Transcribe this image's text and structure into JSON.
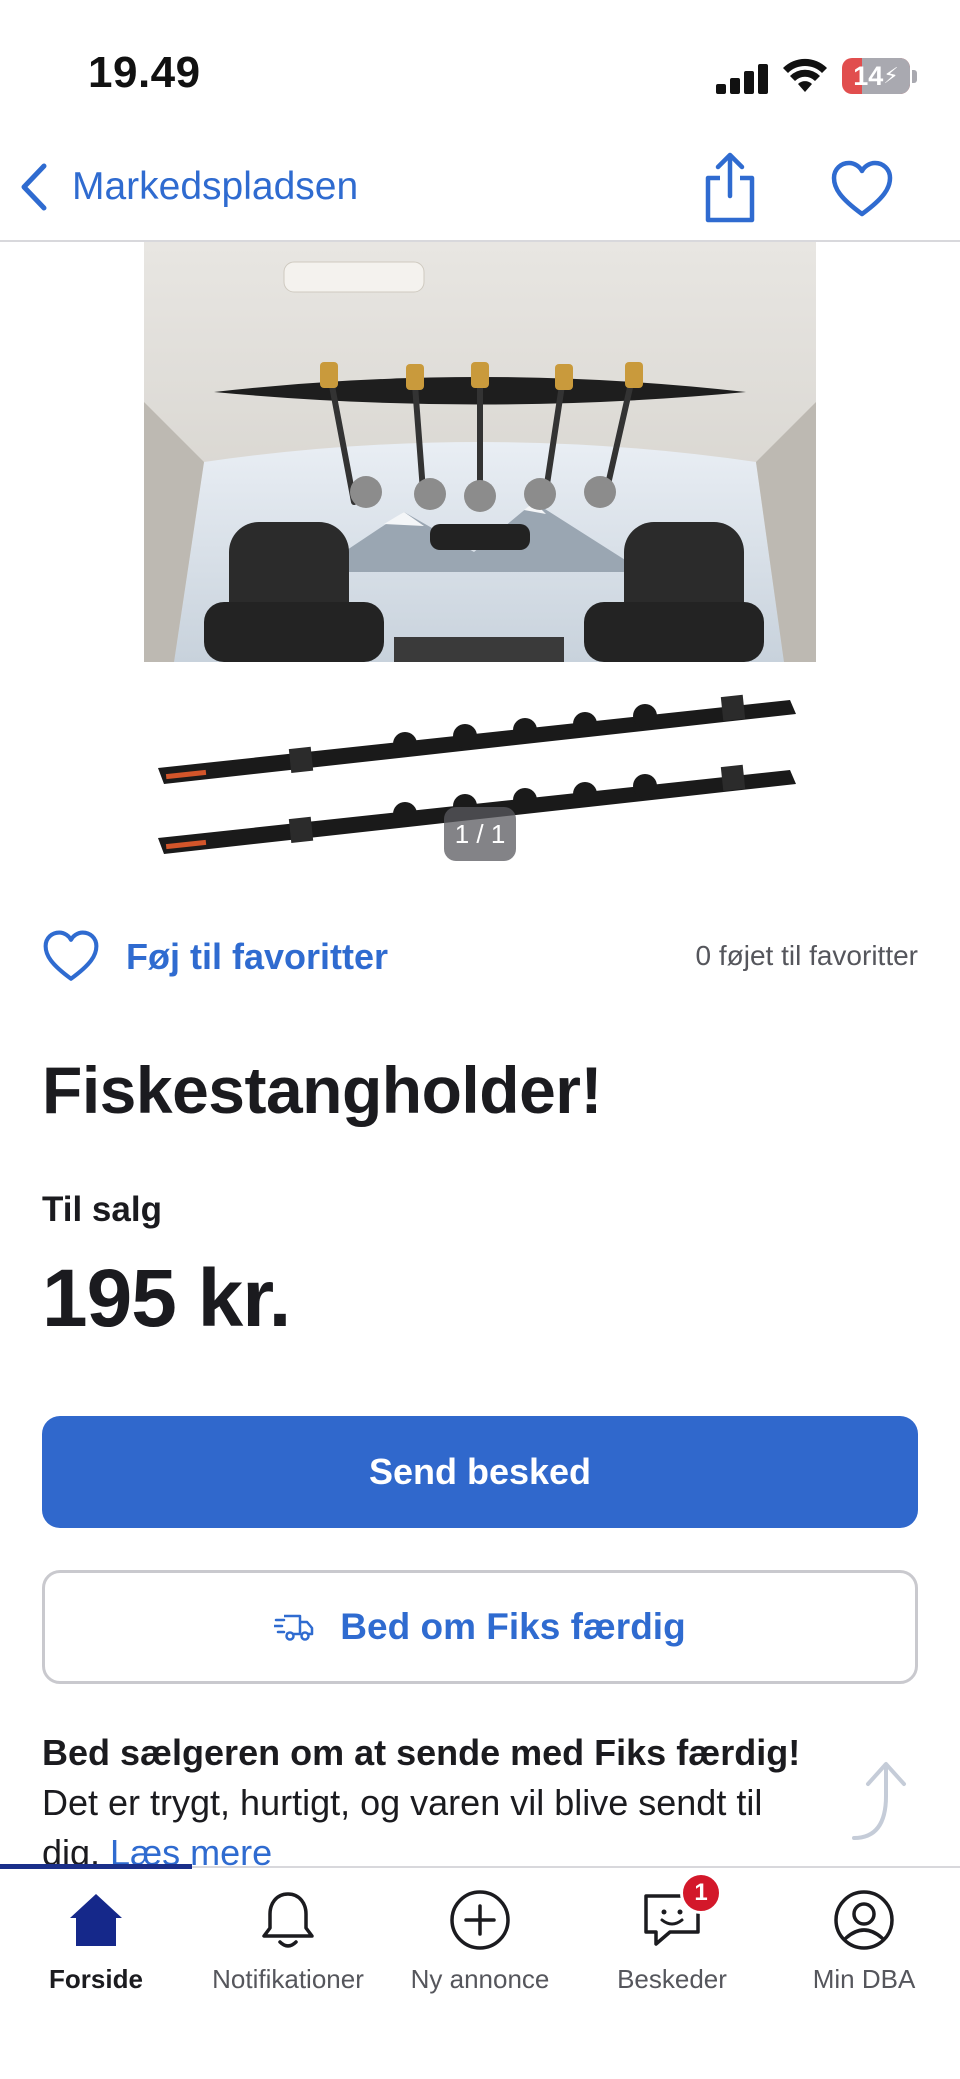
{
  "status_bar": {
    "time": "19.49",
    "battery": "14"
  },
  "nav": {
    "back_label": "Markedspladsen",
    "icons": [
      "chevron-left-icon",
      "share-icon",
      "heart-icon"
    ],
    "accent": "#2f6bd0"
  },
  "gallery": {
    "counter": "1 / 1"
  },
  "favorites": {
    "add_label": "Føj til favoritter",
    "count_text": "0 føjet til favoritter"
  },
  "listing": {
    "title": "Fiskestangholder!",
    "sale_type": "Til salg",
    "price": "195 kr."
  },
  "actions": {
    "send_label": "Send besked",
    "fiks_label": "Bed om Fiks færdig",
    "primary_color": "#3068cc"
  },
  "info": {
    "bold_text": "Bed sælgeren om at sende med Fiks færdig!",
    "body_text": " Det er trygt, hurtigt, og varen vil blive sendt til dig. ",
    "link_text": "Læs mere"
  },
  "tab_bar": {
    "tabs": [
      {
        "label": "Forside",
        "icon": "home-icon",
        "active": true
      },
      {
        "label": "Notifikationer",
        "icon": "bell-icon",
        "active": false
      },
      {
        "label": "Ny annonce",
        "icon": "plus-circle-icon",
        "active": false
      },
      {
        "label": "Beskeder",
        "icon": "chat-icon",
        "active": false,
        "badge": "1"
      },
      {
        "label": "Min DBA",
        "icon": "profile-icon",
        "active": false
      }
    ]
  }
}
